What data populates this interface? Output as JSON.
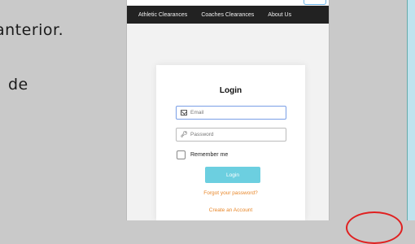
{
  "slide": {
    "line1": "anterior.",
    "line2": "de"
  },
  "nav": {
    "items": [
      "Athletic Clearances",
      "Coaches Clearances",
      "About Us"
    ]
  },
  "login": {
    "title": "Login",
    "email_placeholder": "Email",
    "password_placeholder": "Password",
    "remember_label": "Remember me",
    "remember_checked": false,
    "submit_label": "Login",
    "forgot_link": "Forgot your password?",
    "create_link": "Create an Account"
  },
  "colors": {
    "navbar": "#222222",
    "button": "#6ccfe0",
    "link": "#e8872a",
    "annotation_circle": "#e02020"
  },
  "icons": {
    "email": "envelope-icon",
    "password": "key-icon"
  }
}
